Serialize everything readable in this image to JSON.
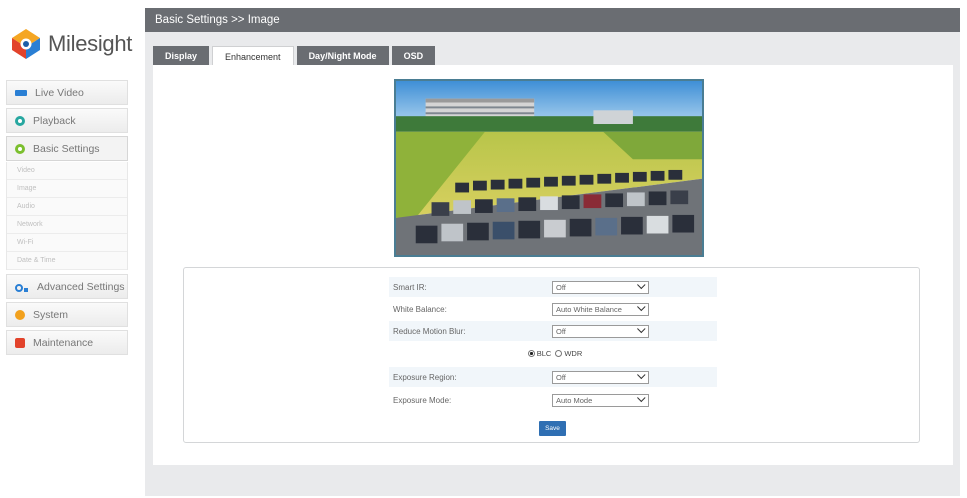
{
  "brand": {
    "name": "Milesight"
  },
  "sidebar": {
    "items": [
      {
        "label": "Live Video",
        "icon": "live-video-icon"
      },
      {
        "label": "Playback",
        "icon": "playback-icon"
      },
      {
        "label": "Basic Settings",
        "icon": "basic-settings-icon"
      },
      {
        "label": "Advanced Settings",
        "icon": "advanced-settings-icon"
      },
      {
        "label": "System",
        "icon": "system-icon"
      },
      {
        "label": "Maintenance",
        "icon": "maintenance-icon"
      }
    ],
    "sub_items": [
      "Video",
      "Image",
      "Audio",
      "Network",
      "Wi-Fi",
      "Date & Time"
    ]
  },
  "header": {
    "title": "Basic Settings >> Image"
  },
  "tabs": [
    "Display",
    "Enhancement",
    "Day/Night Mode",
    "OSD"
  ],
  "active_tab": "Enhancement",
  "form": {
    "smart_ir": {
      "label": "Smart IR:",
      "value": "Off"
    },
    "white_balance": {
      "label": "White Balance:",
      "value": "Auto White Balance"
    },
    "reduce_motion_blur": {
      "label": "Reduce Motion Blur:",
      "value": "Off"
    },
    "backlight": {
      "blc_label": "BLC",
      "wdr_label": "WDR",
      "selected": "BLC"
    },
    "exposure_region": {
      "label": "Exposure Region:",
      "value": "Off"
    },
    "exposure_mode": {
      "label": "Exposure Mode:",
      "value": "Auto Mode"
    },
    "save_label": "Save"
  },
  "colors": {
    "header": "#6a6d72",
    "accent": "#2f6fb3",
    "panel_bg": "#e9eaec"
  }
}
